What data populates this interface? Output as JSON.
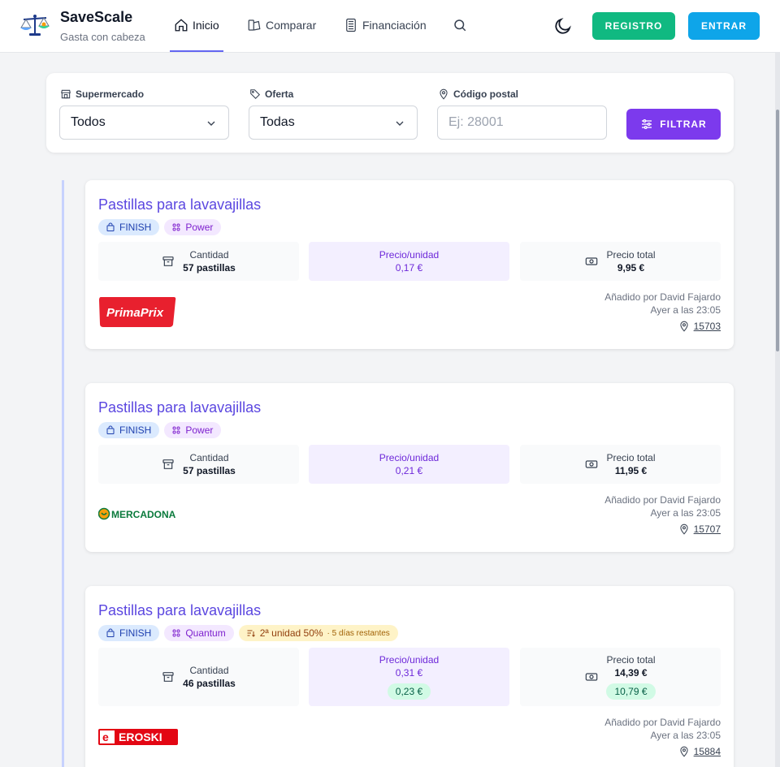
{
  "header": {
    "brand_title": "SaveScale",
    "brand_subtitle": "Gasta con cabeza",
    "nav": [
      {
        "label": "Inicio",
        "icon": "home-icon",
        "active": true
      },
      {
        "label": "Comparar",
        "icon": "compare-icon"
      },
      {
        "label": "Financiación",
        "icon": "calculator-icon"
      }
    ],
    "register_label": "REGISTRO",
    "login_label": "ENTRAR"
  },
  "filters": {
    "supermarket_label": "Supermercado",
    "supermarket_value": "Todos",
    "offer_label": "Oferta",
    "offer_value": "Todas",
    "postal_label": "Código postal",
    "postal_placeholder": "Ej: 28001",
    "filter_label": "FILTRAR"
  },
  "offers": [
    {
      "title": "Pastillas para lavavajillas",
      "brand": "FINISH",
      "variant": "Power",
      "quantity_label": "Cantidad",
      "quantity": "57 pastillas",
      "unit_price_label": "Precio/unidad",
      "unit_price": "0,17 €",
      "total_label": "Precio total",
      "total": "9,95 €",
      "store": "PrimaPrix",
      "added_by": "Añadido por David Fajardo",
      "added_when": "Ayer a las 23:05",
      "postal_code": "15703"
    },
    {
      "title": "Pastillas para lavavajillas",
      "brand": "FINISH",
      "variant": "Power",
      "quantity_label": "Cantidad",
      "quantity": "57 pastillas",
      "unit_price_label": "Precio/unidad",
      "unit_price": "0,21 €",
      "total_label": "Precio total",
      "total": "11,95 €",
      "store": "MERCADONA",
      "added_by": "Añadido por David Fajardo",
      "added_when": "Ayer a las 23:05",
      "postal_code": "15707"
    },
    {
      "title": "Pastillas para lavavajillas",
      "brand": "FINISH",
      "variant": "Quantum",
      "promo": "2ª unidad 50%",
      "promo_remaining": "· 5 días restantes",
      "quantity_label": "Cantidad",
      "quantity": "46 pastillas",
      "unit_price_label": "Precio/unidad",
      "unit_price": "0,31 €",
      "unit_price_offer": "0,23 €",
      "total_label": "Precio total",
      "total": "14,39 €",
      "total_offer": "10,79 €",
      "store": "EROSKI",
      "added_by": "Añadido por David Fajardo",
      "added_when": "Ayer a las 23:05",
      "postal_code": "15884"
    }
  ],
  "colors": {
    "accent": "#6366f1",
    "title": "#5b47e0",
    "register": "#10b981",
    "login": "#0ea5e9",
    "filter": "#7c3aed"
  }
}
